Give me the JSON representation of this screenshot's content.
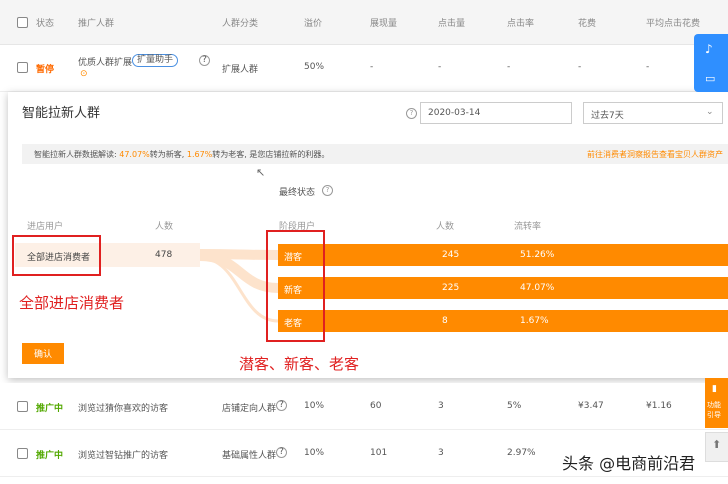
{
  "table_header": {
    "cols": [
      "状态",
      "推广人群",
      "人群分类",
      "溢价",
      "展现量",
      "点击量",
      "点击率",
      "花费",
      "平均点击花费"
    ]
  },
  "row_top": {
    "status": "暂停",
    "name": "优质人群扩展",
    "tag": "扩量助手",
    "category": "扩展人群",
    "premium": "50%",
    "impressions": "-",
    "clicks": "-",
    "ctr": "-",
    "cost": "-",
    "avg_cpc": "-"
  },
  "modal": {
    "title": "智能拉新人群",
    "date_value": "2020-03-14",
    "range_value": "过去7天",
    "banner": {
      "prefix": "智能拉新人群数据解读: ",
      "pct_new": "47.07%",
      "mid1": "转为新客, ",
      "pct_old": "1.67%",
      "mid2": "转为老客, 是您店铺拉新的利器。",
      "link": "前往消费者洞察报告查看宝贝人群资产"
    },
    "final_state_label": "最终状态",
    "left_headers": {
      "users": "进店用户",
      "count": "人数"
    },
    "right_headers": {
      "stage": "阶段用户",
      "count": "人数",
      "rate": "流转率"
    },
    "source": {
      "label": "全部进店消费者",
      "count": "478"
    },
    "flows": [
      {
        "label": "潜客",
        "count": "245",
        "rate": "51.26%"
      },
      {
        "label": "新客",
        "count": "225",
        "rate": "47.07%"
      },
      {
        "label": "老客",
        "count": "8",
        "rate": "1.67%"
      }
    ],
    "confirm": "确认"
  },
  "annotations": {
    "left": "全部进店消费者",
    "bottom": "潜客、新客、老客"
  },
  "row_a": {
    "status": "推广中",
    "name": "浏览过猜你喜欢的访客",
    "category": "店铺定向人群",
    "premium": "10%",
    "impressions": "60",
    "clicks": "3",
    "ctr": "5%",
    "cost": "¥3.47",
    "avg_cpc": "¥1.16"
  },
  "row_b": {
    "status": "推广中",
    "name": "浏览过智钻推广的访客",
    "category": "基础属性人群",
    "premium": "10%",
    "impressions": "101",
    "clicks": "3",
    "ctr": "2.97%"
  },
  "side": {
    "feedback": "功能引导"
  },
  "watermark": "头条 @电商前沿君",
  "colors": {
    "accent": "#ff8a00",
    "annotation": "#e02020",
    "side": "#2f8fff",
    "active": "#52a800"
  }
}
